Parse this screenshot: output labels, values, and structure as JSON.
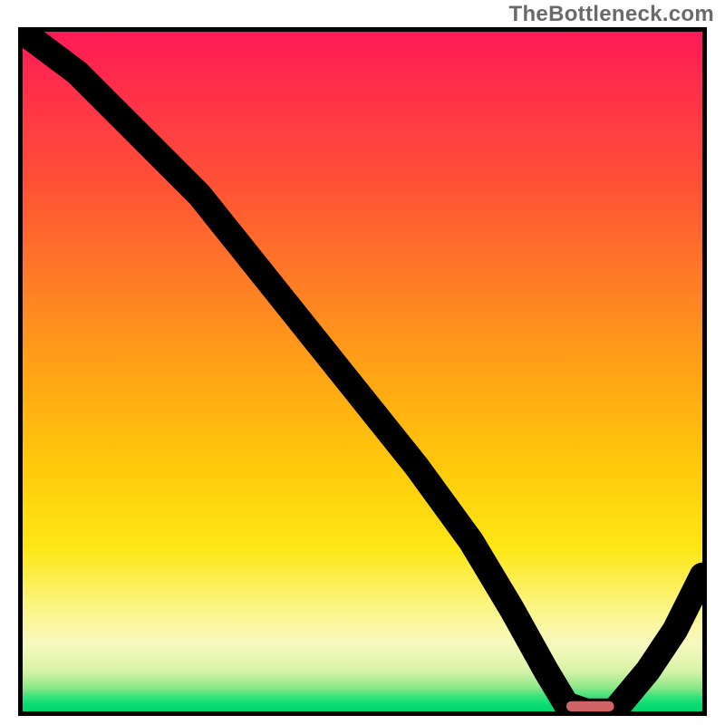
{
  "watermark": "TheBottleneck.com",
  "chart_data": {
    "type": "line",
    "title": "",
    "xlabel": "",
    "ylabel": "",
    "xlim": [
      0,
      100
    ],
    "ylim": [
      0,
      100
    ],
    "grid": false,
    "legend": false,
    "background": "heatmap-gradient-vertical",
    "series": [
      {
        "name": "bottleneck-curve",
        "x": [
          0,
          8,
          20,
          26,
          34,
          42,
          50,
          58,
          66,
          72,
          77,
          80,
          83,
          87,
          92,
          96,
          100
        ],
        "y": [
          100,
          94,
          82,
          76,
          66,
          56,
          46,
          36,
          25,
          15,
          6,
          1,
          0,
          0,
          6,
          12,
          20
        ]
      }
    ],
    "marker": {
      "name": "optimal-range",
      "shape": "rounded-bar",
      "x_start": 80,
      "x_end": 87,
      "y": 0,
      "color": "#d06464"
    },
    "gradient_stops": [
      {
        "pos": 0.0,
        "color": "#ff1a57"
      },
      {
        "pos": 0.5,
        "color": "#ffa316"
      },
      {
        "pos": 0.8,
        "color": "#fbf47a"
      },
      {
        "pos": 0.97,
        "color": "#2fe27a"
      },
      {
        "pos": 1.0,
        "color": "#06d56e"
      }
    ]
  }
}
